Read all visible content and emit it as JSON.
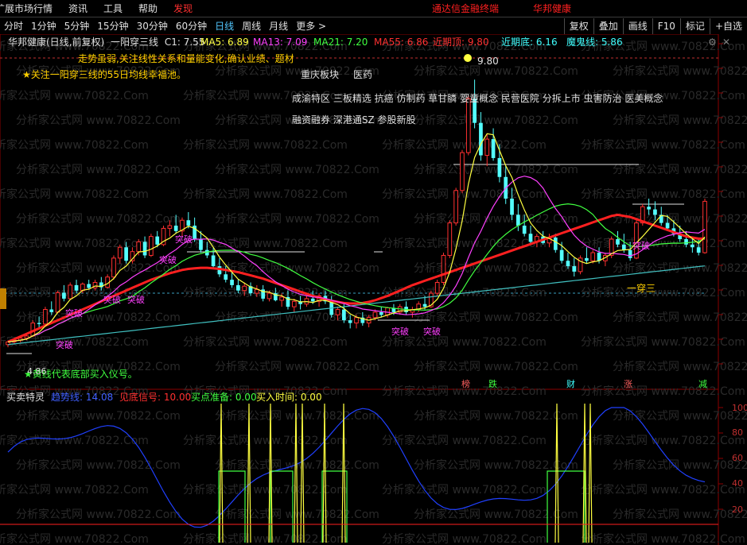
{
  "menu": {
    "items": [
      "扩展市场行情",
      "资讯",
      "工具",
      "帮助"
    ],
    "highlight": "发现",
    "brand": "通达信金融终端",
    "stock": "华邦健康"
  },
  "periods": [
    "分时",
    "1分钟",
    "5分钟",
    "15分钟",
    "30分钟",
    "60分钟",
    "日线",
    "周线",
    "月线",
    "更多 >"
  ],
  "active_period": "日线",
  "toolbar": [
    "复权",
    "叠加",
    "画线",
    "F10",
    "标记",
    "+自选"
  ],
  "header": {
    "name": "华邦健康(日线,前复权)",
    "indicator": "一阳穿三线",
    "close": "C1: 7.55",
    "ma5": "MA5: 6.89",
    "ma13": "MA13: 7.09",
    "ma21": "MA21: 7.20",
    "ma55": "MA55: 6.86",
    "recent_top": "近期顶: 9.80",
    "recent_bottom": "近期底: 6.16",
    "demon_line": "魔鬼线: 5.86"
  },
  "notes": {
    "line1": "走势虽弱,关注线性关系和量能变化,确认业绩、题材",
    "line2": "★关注一阳穿三线的55日均线幸福池。",
    "sector": "重庆板块",
    "industry": "医药",
    "concepts1": "成渝特区 三板精选 抗癌 仿制药 草甘膦 婴童概念 民营医院 分拆上市 虫害防治 医美概念",
    "concepts2": "融资融券 深港通SZ 参股新股",
    "bottom_note": "★黄线代表底部买入仪号。"
  },
  "price_labels": {
    "high": "9.80",
    "low": "4.86"
  },
  "signal_labels": {
    "breakout": "突破",
    "one_sun": "一穿三"
  },
  "event_markers": [
    "榜",
    "跌",
    "财",
    "涨",
    "减"
  ],
  "sub_panel": {
    "name": "买卖特灵",
    "trend": "趋势线: 14.08",
    "bottom_signal": "见底信号: 10.00",
    "buy_ready": "买点准备: 0.00",
    "buy_time": "买入时间: 0.00",
    "ticks": [
      "100",
      "80",
      "60",
      "40",
      "20"
    ]
  },
  "watermark": "分析家公式网 www.70822.Com",
  "colors": {
    "up": "#ff3030",
    "down": "#54ffff",
    "ma5": "#ffff40",
    "ma13": "#ff40ff",
    "ma21": "#40ff40",
    "ma55": "#ff2020",
    "ma_long": "#40c0c0"
  },
  "chart_data": {
    "type": "line",
    "ylim": [
      4.5,
      10.2
    ],
    "candles": [
      [
        4.9,
        4.98,
        4.85,
        4.95
      ],
      [
        4.95,
        5.02,
        4.9,
        4.98
      ],
      [
        4.98,
        5.05,
        4.94,
        5.02
      ],
      [
        5.02,
        5.1,
        4.98,
        5.06
      ],
      [
        5.06,
        5.35,
        5.04,
        5.3
      ],
      [
        5.3,
        5.42,
        5.2,
        5.28
      ],
      [
        5.28,
        5.6,
        5.25,
        5.55
      ],
      [
        5.55,
        5.7,
        5.45,
        5.5
      ],
      [
        5.5,
        5.9,
        5.48,
        5.86
      ],
      [
        5.86,
        6.0,
        5.7,
        5.75
      ],
      [
        5.75,
        6.05,
        5.72,
        6.0
      ],
      [
        6.0,
        6.1,
        5.85,
        5.9
      ],
      [
        5.9,
        6.05,
        5.85,
        6.02
      ],
      [
        6.02,
        6.1,
        5.92,
        5.95
      ],
      [
        5.95,
        6.1,
        5.9,
        6.05
      ],
      [
        6.05,
        6.15,
        5.9,
        5.96
      ],
      [
        5.96,
        6.2,
        5.94,
        6.15
      ],
      [
        6.15,
        6.55,
        6.1,
        6.5
      ],
      [
        6.5,
        6.75,
        6.4,
        6.7
      ],
      [
        6.7,
        6.8,
        6.4,
        6.45
      ],
      [
        6.45,
        6.7,
        6.4,
        6.62
      ],
      [
        6.62,
        6.85,
        6.55,
        6.8
      ],
      [
        6.8,
        6.9,
        6.5,
        6.55
      ],
      [
        6.55,
        6.95,
        6.52,
        6.9
      ],
      [
        6.9,
        7.0,
        6.7,
        6.75
      ],
      [
        6.75,
        7.1,
        6.72,
        7.05
      ],
      [
        7.05,
        7.2,
        6.9,
        7.1
      ],
      [
        7.1,
        7.3,
        6.95,
        7.0
      ],
      [
        7.0,
        7.25,
        6.9,
        7.2
      ],
      [
        7.2,
        7.35,
        7.05,
        7.1
      ],
      [
        7.1,
        7.25,
        6.8,
        6.85
      ],
      [
        6.85,
        7.0,
        6.6,
        6.65
      ],
      [
        6.65,
        6.8,
        6.5,
        6.55
      ],
      [
        6.55,
        6.7,
        6.3,
        6.35
      ],
      [
        6.35,
        6.5,
        6.15,
        6.2
      ],
      [
        6.2,
        6.35,
        6.05,
        6.1
      ],
      [
        6.1,
        6.25,
        5.95,
        6.0
      ],
      [
        6.0,
        6.1,
        5.85,
        5.9
      ],
      [
        5.9,
        6.05,
        5.8,
        5.98
      ],
      [
        5.98,
        6.05,
        5.8,
        5.85
      ],
      [
        5.85,
        6.0,
        5.78,
        5.92
      ],
      [
        5.92,
        6.0,
        5.7,
        5.75
      ],
      [
        5.75,
        5.9,
        5.7,
        5.85
      ],
      [
        5.85,
        5.95,
        5.7,
        5.72
      ],
      [
        5.72,
        5.85,
        5.6,
        5.78
      ],
      [
        5.78,
        5.9,
        5.55,
        5.6
      ],
      [
        5.6,
        5.75,
        5.5,
        5.7
      ],
      [
        5.7,
        5.8,
        5.55,
        5.65
      ],
      [
        5.65,
        5.8,
        5.6,
        5.75
      ],
      [
        5.75,
        5.9,
        5.65,
        5.7
      ],
      [
        5.7,
        5.85,
        5.6,
        5.8
      ],
      [
        5.8,
        5.9,
        5.65,
        5.7
      ],
      [
        5.7,
        5.8,
        5.4,
        5.45
      ],
      [
        5.45,
        5.6,
        5.35,
        5.55
      ],
      [
        5.55,
        5.65,
        5.3,
        5.35
      ],
      [
        5.35,
        5.45,
        5.2,
        5.3
      ],
      [
        5.3,
        5.45,
        5.2,
        5.4
      ],
      [
        5.4,
        5.5,
        5.25,
        5.3
      ],
      [
        5.3,
        5.45,
        5.22,
        5.4
      ],
      [
        5.4,
        5.55,
        5.35,
        5.5
      ],
      [
        5.5,
        5.6,
        5.4,
        5.45
      ],
      [
        5.45,
        5.6,
        5.4,
        5.58
      ],
      [
        5.58,
        5.65,
        5.45,
        5.5
      ],
      [
        5.5,
        5.65,
        5.45,
        5.6
      ],
      [
        5.6,
        5.7,
        5.45,
        5.5
      ],
      [
        5.5,
        5.6,
        5.4,
        5.55
      ],
      [
        5.55,
        5.7,
        5.5,
        5.65
      ],
      [
        5.65,
        5.8,
        5.55,
        5.6
      ],
      [
        5.6,
        5.9,
        5.58,
        5.85
      ],
      [
        5.85,
        6.1,
        5.8,
        6.05
      ],
      [
        6.05,
        6.6,
        6.0,
        6.55
      ],
      [
        6.55,
        7.2,
        6.5,
        7.15
      ],
      [
        7.15,
        7.8,
        7.1,
        7.75
      ],
      [
        7.75,
        8.5,
        7.7,
        8.45
      ],
      [
        8.45,
        9.5,
        8.4,
        9.45
      ],
      [
        9.45,
        9.8,
        8.9,
        9.0
      ],
      [
        9.0,
        9.2,
        8.3,
        8.4
      ],
      [
        8.4,
        8.8,
        8.2,
        8.7
      ],
      [
        8.7,
        8.9,
        8.3,
        8.35
      ],
      [
        8.35,
        8.6,
        7.9,
        8.0
      ],
      [
        8.0,
        8.2,
        7.5,
        7.6
      ],
      [
        7.6,
        7.8,
        7.2,
        7.3
      ],
      [
        7.3,
        7.5,
        7.0,
        7.1
      ],
      [
        7.1,
        7.3,
        6.9,
        6.95
      ],
      [
        6.95,
        7.1,
        6.75,
        6.8
      ],
      [
        6.8,
        6.95,
        6.7,
        6.9
      ],
      [
        6.9,
        7.0,
        6.75,
        6.78
      ],
      [
        6.78,
        6.95,
        6.7,
        6.88
      ],
      [
        6.88,
        6.95,
        6.6,
        6.65
      ],
      [
        6.65,
        6.8,
        6.4,
        6.45
      ],
      [
        6.45,
        6.6,
        6.3,
        6.35
      ],
      [
        6.35,
        6.5,
        6.16,
        6.25
      ],
      [
        6.25,
        6.55,
        6.2,
        6.5
      ],
      [
        6.5,
        6.7,
        6.4,
        6.45
      ],
      [
        6.45,
        6.65,
        6.4,
        6.6
      ],
      [
        6.6,
        6.7,
        6.4,
        6.45
      ],
      [
        6.45,
        6.6,
        6.35,
        6.55
      ],
      [
        6.55,
        6.9,
        6.5,
        6.85
      ],
      [
        6.85,
        7.0,
        6.7,
        6.75
      ],
      [
        6.75,
        6.95,
        6.6,
        6.65
      ],
      [
        6.65,
        6.8,
        6.45,
        6.5
      ],
      [
        6.5,
        7.2,
        6.48,
        7.15
      ],
      [
        7.15,
        7.5,
        7.1,
        7.45
      ],
      [
        7.45,
        7.6,
        7.3,
        7.4
      ],
      [
        7.4,
        7.55,
        7.2,
        7.3
      ],
      [
        7.3,
        7.45,
        7.1,
        7.15
      ],
      [
        7.15,
        7.3,
        7.0,
        7.05
      ],
      [
        7.05,
        7.2,
        6.9,
        6.95
      ],
      [
        6.95,
        7.1,
        6.8,
        6.85
      ],
      [
        6.85,
        7.0,
        6.7,
        6.75
      ],
      [
        6.75,
        6.9,
        6.6,
        6.7
      ],
      [
        6.7,
        6.85,
        6.55,
        6.6
      ],
      [
        6.6,
        7.6,
        6.58,
        7.55
      ]
    ],
    "ma55": [
      4.95,
      5.0,
      5.05,
      5.1,
      5.15,
      5.2,
      5.25,
      5.3,
      5.35,
      5.4,
      5.45,
      5.5,
      5.55,
      5.6,
      5.65,
      5.7,
      5.75,
      5.8,
      5.85,
      5.9,
      5.95,
      6.0,
      6.05,
      6.1,
      6.14,
      6.18,
      6.22,
      6.25,
      6.28,
      6.3,
      6.31,
      6.32,
      6.32,
      6.31,
      6.3,
      6.28,
      6.26,
      6.24,
      6.21,
      6.18,
      6.15,
      6.12,
      6.08,
      6.04,
      6.0,
      5.96,
      5.92,
      5.88,
      5.84,
      5.8,
      5.77,
      5.74,
      5.71,
      5.69,
      5.67,
      5.66,
      5.66,
      5.67,
      5.69,
      5.72,
      5.76,
      5.8,
      5.85,
      5.9,
      5.95,
      6.0,
      6.04,
      6.08,
      6.12,
      6.16,
      6.2,
      6.24,
      6.28,
      6.32,
      6.36,
      6.4,
      6.44,
      6.48,
      6.52,
      6.56,
      6.6,
      6.64,
      6.68,
      6.72,
      6.76,
      6.8,
      6.84,
      6.88,
      6.92,
      6.96,
      7.0,
      7.04,
      7.08,
      7.12,
      7.16,
      7.2,
      7.24,
      7.28,
      7.3,
      7.28,
      7.26,
      7.22,
      7.18,
      7.14,
      7.1,
      7.06,
      7.02,
      6.98,
      6.94,
      6.9,
      6.88,
      6.86,
      6.86
    ],
    "events": [
      "榜",
      "跌",
      "财",
      "涨",
      "减"
    ]
  }
}
